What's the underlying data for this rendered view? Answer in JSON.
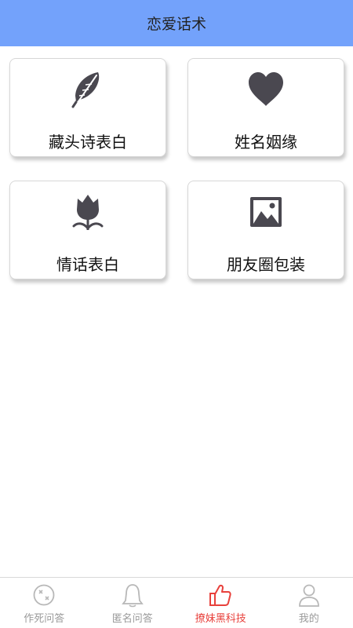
{
  "header": {
    "title": "恋爱话术"
  },
  "cards": [
    {
      "label": "藏头诗表白",
      "icon": "feather-icon"
    },
    {
      "label": "姓名姻缘",
      "icon": "heart-icon"
    },
    {
      "label": "情话表白",
      "icon": "tulip-icon"
    },
    {
      "label": "朋友圈包装",
      "icon": "image-icon"
    }
  ],
  "tabbar": {
    "items": [
      {
        "label": "作死问答",
        "icon": "dizzy-face-icon",
        "active": false
      },
      {
        "label": "匿名问答",
        "icon": "bell-icon",
        "active": false
      },
      {
        "label": "撩妹黑科技",
        "icon": "thumbs-up-icon",
        "active": true
      },
      {
        "label": "我的",
        "icon": "user-icon",
        "active": false
      }
    ]
  },
  "colors": {
    "header_bg": "#73a2fb",
    "icon_dark": "#4a4850",
    "tab_inactive": "#9a9a9a",
    "tab_active": "#e8413c"
  }
}
